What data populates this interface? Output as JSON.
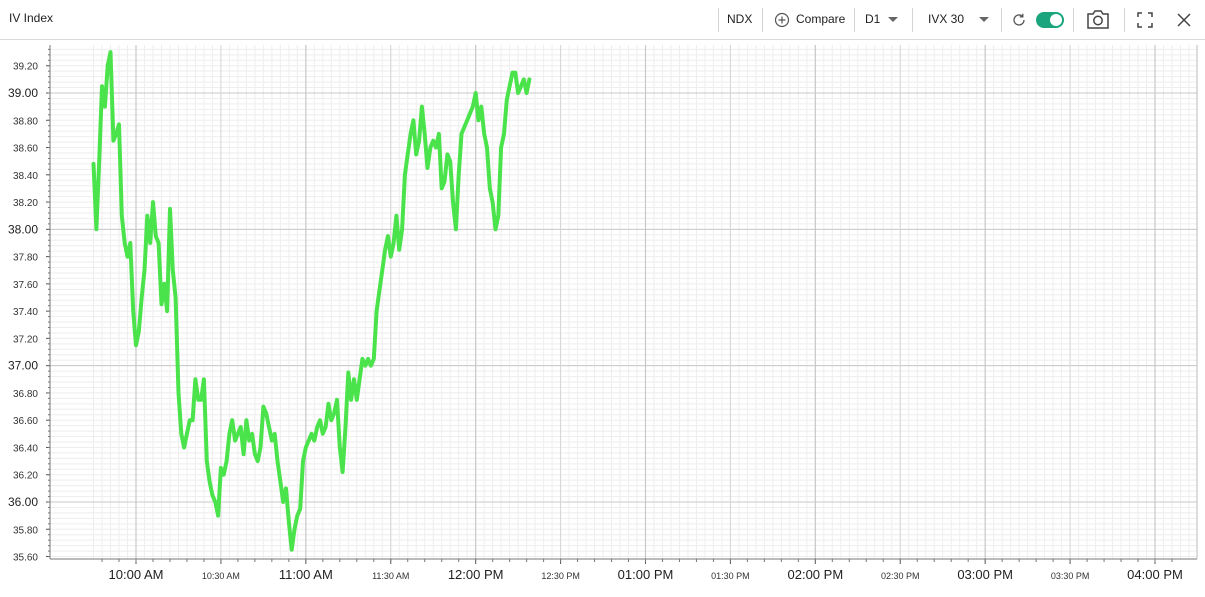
{
  "toolbar": {
    "title": "IV Index",
    "symbol": "NDX",
    "compare_label": "Compare",
    "timeframe": "D1",
    "measure": "IVX 30"
  },
  "icons": {
    "compare": "plus-circle-icon",
    "refresh": "refresh-icon",
    "toggle": "toggle-switch-icon",
    "snapshot": "camera-icon",
    "fullscreen": "fullscreen-icon",
    "close": "close-icon"
  },
  "colors": {
    "line": "#4be34b",
    "toggle": "#1aa57f",
    "grid_major": "#c8c8c8",
    "grid_minor": "#eeeeee"
  },
  "chart_data": {
    "type": "line",
    "title": "IV Index",
    "xlabel": "",
    "ylabel": "",
    "ylim": [
      35.56,
      39.32
    ],
    "grid": true,
    "y_ticks": [
      "35.60",
      "35.80",
      "36.00",
      "36.20",
      "36.40",
      "36.60",
      "36.80",
      "37.00",
      "37.20",
      "37.40",
      "37.60",
      "37.80",
      "38.00",
      "38.20",
      "38.40",
      "38.60",
      "38.80",
      "39.00",
      "39.20"
    ],
    "y_major_ticks": [
      "36.00",
      "37.00",
      "38.00",
      "39.00"
    ],
    "x_ticks": [
      {
        "label": "10:00 AM",
        "t": 600,
        "major": true
      },
      {
        "label": "10:30 AM",
        "t": 630,
        "major": false
      },
      {
        "label": "11:00 AM",
        "t": 660,
        "major": true
      },
      {
        "label": "11:30 AM",
        "t": 690,
        "major": false
      },
      {
        "label": "12:00 PM",
        "t": 720,
        "major": true
      },
      {
        "label": "12:30 PM",
        "t": 750,
        "major": false
      },
      {
        "label": "01:00 PM",
        "t": 780,
        "major": true
      },
      {
        "label": "01:30 PM",
        "t": 810,
        "major": false
      },
      {
        "label": "02:00 PM",
        "t": 840,
        "major": true
      },
      {
        "label": "02:30 PM",
        "t": 870,
        "major": false
      },
      {
        "label": "03:00 PM",
        "t": 900,
        "major": true
      },
      {
        "label": "03:30 PM",
        "t": 930,
        "major": false
      },
      {
        "label": "04:00 PM",
        "t": 960,
        "major": true
      }
    ],
    "series": [
      {
        "name": "IVX 30",
        "points": [
          [
            585,
            38.48
          ],
          [
            586,
            38.0
          ],
          [
            587,
            38.5
          ],
          [
            588,
            39.05
          ],
          [
            589,
            38.9
          ],
          [
            590,
            39.2
          ],
          [
            591,
            39.3
          ],
          [
            592,
            38.65
          ],
          [
            593,
            38.7
          ],
          [
            594,
            38.77
          ],
          [
            595,
            38.1
          ],
          [
            596,
            37.9
          ],
          [
            597,
            37.8
          ],
          [
            598,
            37.9
          ],
          [
            599,
            37.4
          ],
          [
            600,
            37.15
          ],
          [
            601,
            37.25
          ],
          [
            602,
            37.5
          ],
          [
            603,
            37.7
          ],
          [
            604,
            38.1
          ],
          [
            605,
            37.9
          ],
          [
            606,
            38.2
          ],
          [
            607,
            37.95
          ],
          [
            608,
            37.9
          ],
          [
            609,
            37.45
          ],
          [
            610,
            37.6
          ],
          [
            611,
            37.4
          ],
          [
            612,
            38.15
          ],
          [
            613,
            37.7
          ],
          [
            614,
            37.5
          ],
          [
            615,
            36.8
          ],
          [
            616,
            36.5
          ],
          [
            617,
            36.4
          ],
          [
            618,
            36.5
          ],
          [
            619,
            36.6
          ],
          [
            620,
            36.6
          ],
          [
            621,
            36.9
          ],
          [
            622,
            36.75
          ],
          [
            623,
            36.75
          ],
          [
            624,
            36.9
          ],
          [
            625,
            36.3
          ],
          [
            626,
            36.15
          ],
          [
            627,
            36.05
          ],
          [
            628,
            36.0
          ],
          [
            629,
            35.9
          ],
          [
            630,
            36.25
          ],
          [
            631,
            36.2
          ],
          [
            632,
            36.3
          ],
          [
            633,
            36.5
          ],
          [
            634,
            36.6
          ],
          [
            635,
            36.45
          ],
          [
            636,
            36.5
          ],
          [
            637,
            36.55
          ],
          [
            638,
            36.35
          ],
          [
            639,
            36.6
          ],
          [
            640,
            36.45
          ],
          [
            641,
            36.5
          ],
          [
            642,
            36.35
          ],
          [
            643,
            36.3
          ],
          [
            644,
            36.4
          ],
          [
            645,
            36.7
          ],
          [
            646,
            36.65
          ],
          [
            647,
            36.55
          ],
          [
            648,
            36.45
          ],
          [
            649,
            36.5
          ],
          [
            650,
            36.3
          ],
          [
            651,
            36.15
          ],
          [
            652,
            36.0
          ],
          [
            653,
            36.1
          ],
          [
            654,
            35.85
          ],
          [
            655,
            35.65
          ],
          [
            656,
            35.8
          ],
          [
            657,
            35.9
          ],
          [
            658,
            35.95
          ],
          [
            659,
            36.3
          ],
          [
            660,
            36.4
          ],
          [
            661,
            36.45
          ],
          [
            662,
            36.5
          ],
          [
            663,
            36.45
          ],
          [
            664,
            36.55
          ],
          [
            665,
            36.6
          ],
          [
            666,
            36.5
          ],
          [
            667,
            36.55
          ],
          [
            668,
            36.72
          ],
          [
            669,
            36.6
          ],
          [
            670,
            36.65
          ],
          [
            671,
            36.75
          ],
          [
            672,
            36.4
          ],
          [
            673,
            36.22
          ],
          [
            674,
            36.55
          ],
          [
            675,
            36.95
          ],
          [
            676,
            36.75
          ],
          [
            677,
            36.9
          ],
          [
            678,
            36.75
          ],
          [
            679,
            36.9
          ],
          [
            680,
            37.05
          ],
          [
            681,
            37.0
          ],
          [
            682,
            37.05
          ],
          [
            683,
            37.0
          ],
          [
            684,
            37.05
          ],
          [
            685,
            37.4
          ],
          [
            686,
            37.55
          ],
          [
            687,
            37.7
          ],
          [
            688,
            37.85
          ],
          [
            689,
            37.95
          ],
          [
            690,
            37.8
          ],
          [
            691,
            37.9
          ],
          [
            692,
            38.1
          ],
          [
            693,
            37.85
          ],
          [
            694,
            38.0
          ],
          [
            695,
            38.4
          ],
          [
            696,
            38.55
          ],
          [
            697,
            38.7
          ],
          [
            698,
            38.8
          ],
          [
            699,
            38.55
          ],
          [
            700,
            38.65
          ],
          [
            701,
            38.9
          ],
          [
            702,
            38.7
          ],
          [
            703,
            38.45
          ],
          [
            704,
            38.6
          ],
          [
            705,
            38.65
          ],
          [
            706,
            38.6
          ],
          [
            707,
            38.7
          ],
          [
            708,
            38.3
          ],
          [
            709,
            38.35
          ],
          [
            710,
            38.55
          ],
          [
            711,
            38.5
          ],
          [
            712,
            38.2
          ],
          [
            713,
            38.0
          ],
          [
            714,
            38.4
          ],
          [
            715,
            38.7
          ],
          [
            716,
            38.75
          ],
          [
            717,
            38.8
          ],
          [
            718,
            38.85
          ],
          [
            719,
            38.9
          ],
          [
            720,
            39.0
          ],
          [
            721,
            38.8
          ],
          [
            722,
            38.9
          ],
          [
            723,
            38.7
          ],
          [
            724,
            38.6
          ],
          [
            725,
            38.3
          ],
          [
            726,
            38.2
          ],
          [
            727,
            38.0
          ],
          [
            728,
            38.1
          ],
          [
            729,
            38.6
          ],
          [
            730,
            38.7
          ],
          [
            731,
            38.95
          ],
          [
            732,
            39.05
          ],
          [
            733,
            39.15
          ],
          [
            734,
            39.15
          ],
          [
            735,
            39.0
          ],
          [
            736,
            39.05
          ],
          [
            737,
            39.1
          ],
          [
            738,
            39.0
          ],
          [
            739,
            39.1
          ]
        ]
      }
    ]
  }
}
